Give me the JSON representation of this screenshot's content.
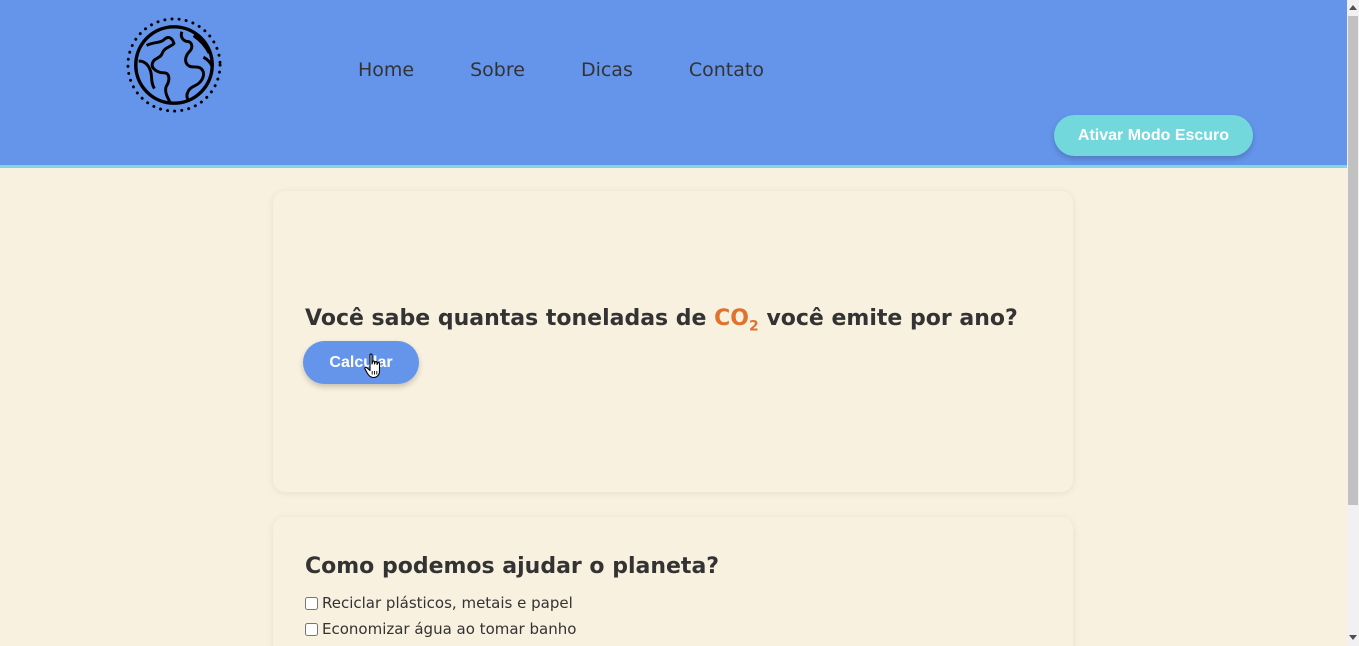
{
  "header": {
    "nav": [
      "Home",
      "Sobre",
      "Dicas",
      "Contato"
    ],
    "dark_mode_button": "Ativar Modo Escuro"
  },
  "calculator": {
    "question_prefix": "Você sabe quantas toneladas de",
    "co2_text": "CO",
    "co2_sub": "2",
    "question_suffix": "você emite por ano?",
    "button": "Calcular"
  },
  "help": {
    "title": "Como podemos ajudar o planeta?",
    "tips": [
      "Reciclar plásticos, metais e papel",
      "Economizar água ao tomar banho"
    ]
  },
  "colors": {
    "header_bg": "#6495ea",
    "page_bg": "#f9f1df",
    "accent_cyan": "#72d8dc",
    "co2_orange": "#e0722e"
  },
  "icons": {
    "logo": "globe-icon",
    "cursor": "hand-pointer-icon"
  }
}
